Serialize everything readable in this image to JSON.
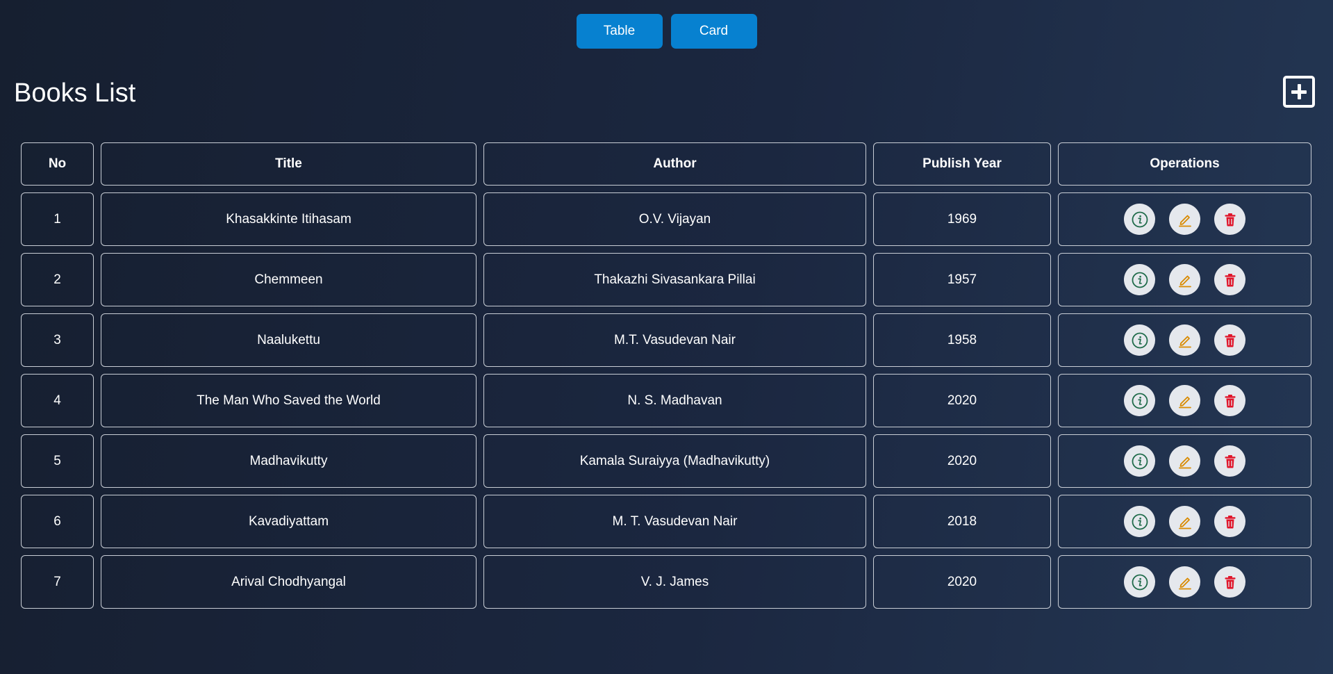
{
  "view_toggle": {
    "table_label": "Table",
    "card_label": "Card"
  },
  "page": {
    "title": "Books List",
    "add_icon": "plus-square-icon"
  },
  "table": {
    "headers": [
      "No",
      "Title",
      "Author",
      "Publish Year",
      "Operations"
    ],
    "rows": [
      {
        "no": "1",
        "title": "Khasakkinte Itihasam",
        "author": "O.V. Vijayan",
        "year": "1969"
      },
      {
        "no": "2",
        "title": "Chemmeen",
        "author": "Thakazhi Sivasankara Pillai",
        "year": "1957"
      },
      {
        "no": "3",
        "title": "Naalukettu",
        "author": "M.T. Vasudevan Nair",
        "year": "1958"
      },
      {
        "no": "4",
        "title": "The Man Who Saved the World",
        "author": "N. S. Madhavan",
        "year": "2020"
      },
      {
        "no": "5",
        "title": "Madhavikutty",
        "author": "Kamala Suraiyya (Madhavikutty)",
        "year": "2020"
      },
      {
        "no": "6",
        "title": "Kavadiyattam",
        "author": "M. T. Vasudevan Nair",
        "year": "2018"
      },
      {
        "no": "7",
        "title": "Arival Chodhyangal",
        "author": "V. J. James",
        "year": "2020"
      }
    ]
  },
  "operations": {
    "icons": [
      "info-circle-icon",
      "edit-pencil-icon",
      "trash-icon"
    ]
  },
  "colors": {
    "button_blue": "#0781d0",
    "info_green": "#1f6b4a",
    "edit_orange": "#d98a00",
    "delete_red": "#e0152a"
  }
}
